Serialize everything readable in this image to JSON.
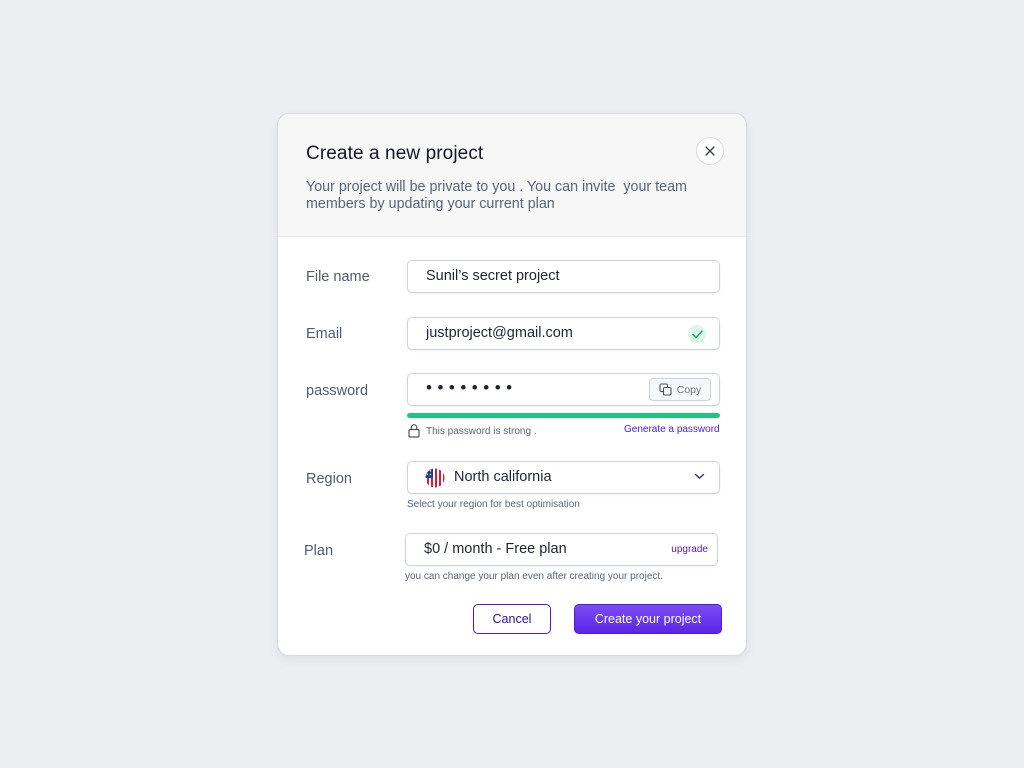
{
  "modal": {
    "title": "Create a new project",
    "subtitle": "Your project will be private to you . You can invite  your team members by updating your current plan",
    "close_icon": "close-icon"
  },
  "form": {
    "file_name": {
      "label": "File name",
      "value": "Sunil’s secret project"
    },
    "email": {
      "label": "Email",
      "value": "justproject@gmail.com",
      "status_icon": "check-icon",
      "status_color": "#1fc47f"
    },
    "password": {
      "label": "password",
      "masked_value": "••••••••",
      "copy_label": "Copy",
      "copy_icon": "copy-icon",
      "strength_fraction": 1.0,
      "strength_color": "#1fc47f",
      "strength_text": "This password is strong .",
      "generate_link": "Generate a password",
      "lock_icon": "lock-icon"
    },
    "region": {
      "label": "Region",
      "value": "North california",
      "flag_icon": "us-flag-icon",
      "dropdown_icon": "chevron-down-icon",
      "helper": "Select your region for best optimisation"
    },
    "plan": {
      "label": "Plan",
      "value": "$0 / month - Free plan",
      "upgrade_link": "upgrade",
      "helper": "you can change your plan even after creating your project."
    }
  },
  "actions": {
    "cancel_label": "Cancel",
    "create_label": "Create your project"
  },
  "colors": {
    "accent": "#4b18d6",
    "primary_gradient_start": "#7d4cf5",
    "primary_gradient_end": "#5a25e6",
    "background": "#eceef1"
  }
}
